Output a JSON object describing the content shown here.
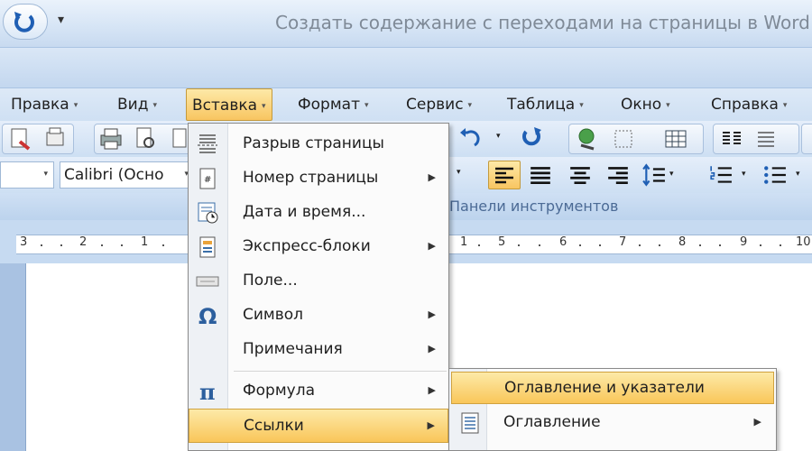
{
  "window": {
    "title": "Создать содержание с переходами на страницы в Word"
  },
  "quick_access": {
    "dropdown_glyph": "▾",
    "undo_icon": "undo-icon"
  },
  "menubar": {
    "items": [
      {
        "label": "Правка"
      },
      {
        "label": "Вид"
      },
      {
        "label": "Вставка"
      },
      {
        "label": "Формат"
      },
      {
        "label": "Сервис"
      },
      {
        "label": "Таблица"
      },
      {
        "label": "Окно"
      },
      {
        "label": "Справка"
      }
    ],
    "active": "Вставка",
    "arrow": "▾"
  },
  "toolbar": {
    "font_name": "Calibri (Осно",
    "panel_label": "Панели инструментов"
  },
  "ruler": {
    "labels": [
      "3",
      "2",
      "1",
      "1",
      "5",
      "6",
      "7",
      "8",
      "9",
      "10"
    ]
  },
  "insert_menu": {
    "items": [
      {
        "label": "Разрыв страницы",
        "submenu": false
      },
      {
        "label": "Номер страницы",
        "submenu": true
      },
      {
        "label": "Дата и время...",
        "submenu": false
      },
      {
        "label": "Экспресс-блоки",
        "submenu": true
      },
      {
        "label": "Поле...",
        "submenu": false
      },
      {
        "label": "Символ",
        "submenu": true
      },
      {
        "label": "Примечания",
        "submenu": true
      },
      {
        "label": "Формула",
        "submenu": true
      },
      {
        "label": "Ссылки",
        "submenu": true
      }
    ],
    "highlighted": "Ссылки",
    "submenu_arrow": "▶"
  },
  "references_submenu": {
    "items": [
      {
        "label": "Оглавление и указатели",
        "submenu": false
      },
      {
        "label": "Оглавление",
        "submenu": true
      }
    ],
    "highlighted": "Оглавление и указатели"
  },
  "colors": {
    "highlight": "#f9c659",
    "ribbon": "#c9dcf1",
    "panel_text": "#4b6a95"
  }
}
